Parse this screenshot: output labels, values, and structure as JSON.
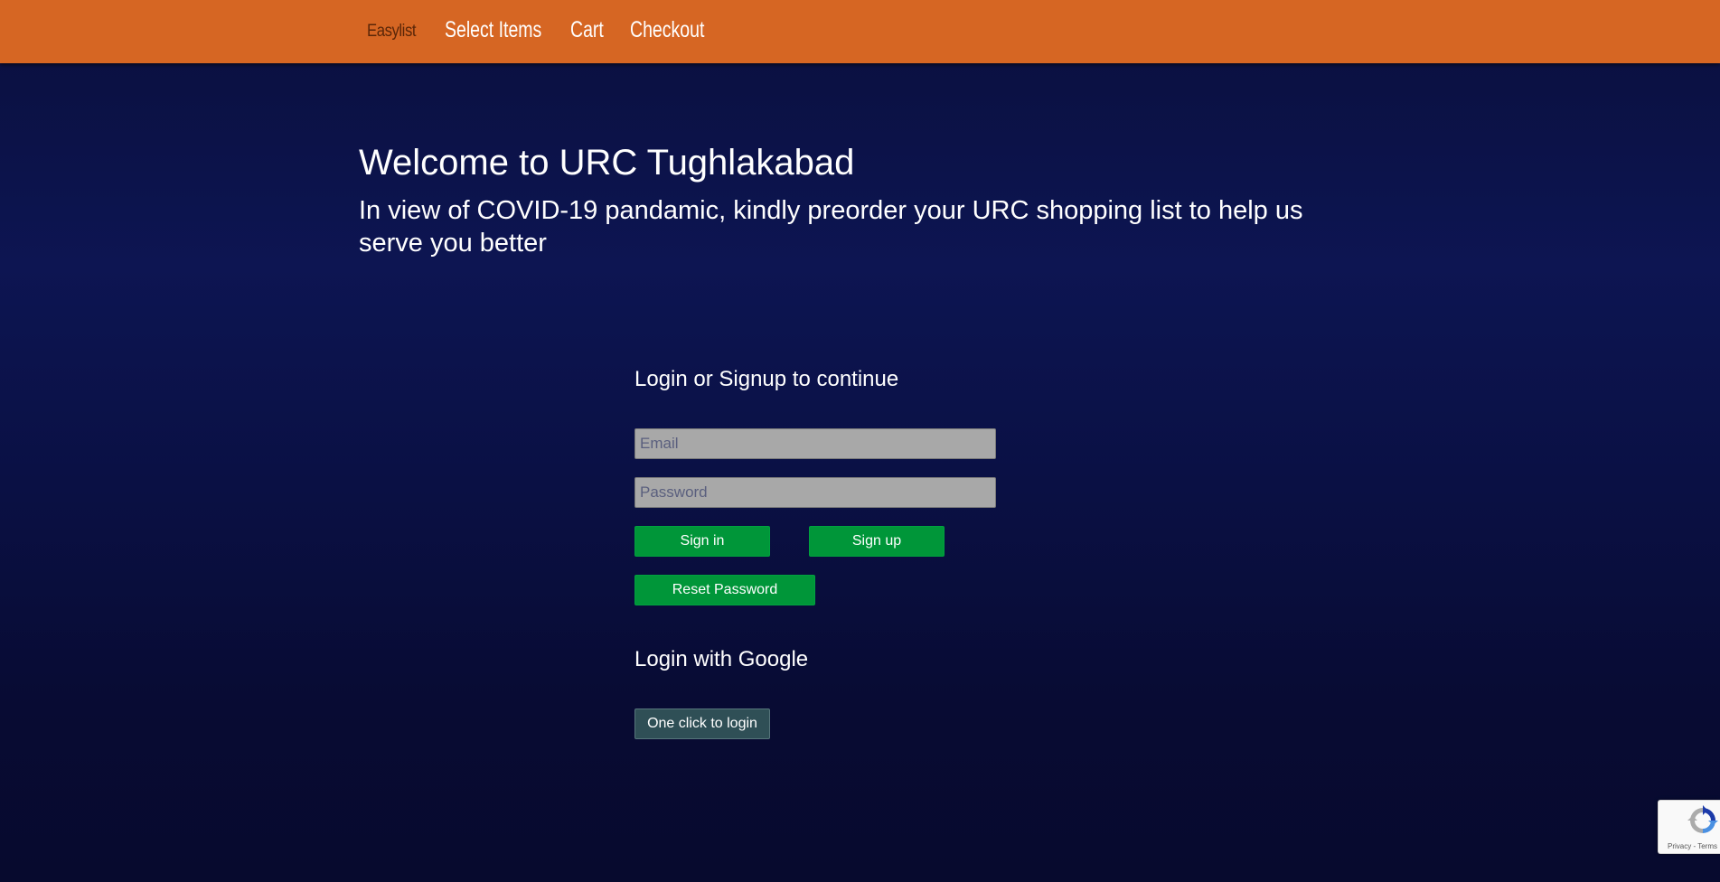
{
  "nav": {
    "brand": "Easylist",
    "links": [
      "Select Items",
      "Cart",
      "Checkout"
    ]
  },
  "hero": {
    "title": "Welcome to URC Tughlakabad",
    "subtitle": "In view of COVID-19 pandamic, kindly preorder your URC shopping list to help us serve you better"
  },
  "login": {
    "heading": "Login or Signup to continue",
    "email_placeholder": "Email",
    "password_placeholder": "Password",
    "signin_label": "Sign in",
    "signup_label": "Sign up",
    "reset_label": "Reset Password"
  },
  "google": {
    "heading": "Login with Google",
    "button_label": "One click to login"
  },
  "recaptcha": {
    "privacy": "Privacy",
    "separator": " - ",
    "terms": "Terms",
    "icon": "recaptcha-icon"
  },
  "colors": {
    "navbar": "#d66623",
    "background": "#0a0f3d",
    "primary_button": "#009639",
    "google_button": "#2f4f56",
    "input": "#a8a8a8"
  }
}
